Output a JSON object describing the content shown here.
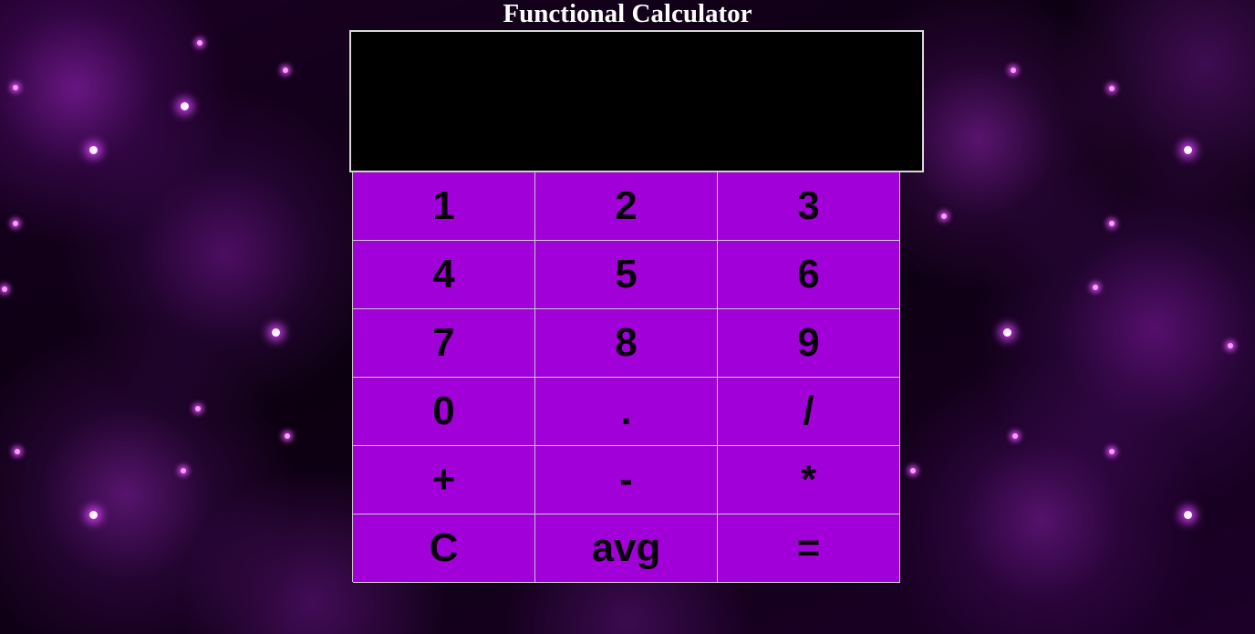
{
  "page": {
    "title": "Functional Calculator",
    "background": "purple-nebula-starfield"
  },
  "display": {
    "value": ""
  },
  "colors": {
    "key_background": "#a100d8",
    "key_text": "#0a000d",
    "display_background": "#000000",
    "grid_lines": "#c9c9c9",
    "title_text": "#ffffff"
  },
  "keypad": {
    "keys": [
      {
        "label": "1"
      },
      {
        "label": "2"
      },
      {
        "label": "3"
      },
      {
        "label": "4"
      },
      {
        "label": "5"
      },
      {
        "label": "6"
      },
      {
        "label": "7"
      },
      {
        "label": "8"
      },
      {
        "label": "9"
      },
      {
        "label": "0"
      },
      {
        "label": "."
      },
      {
        "label": "/"
      },
      {
        "label": "+"
      },
      {
        "label": "-"
      },
      {
        "label": "*"
      },
      {
        "label": "C"
      },
      {
        "label": "avg"
      },
      {
        "label": "="
      }
    ]
  }
}
